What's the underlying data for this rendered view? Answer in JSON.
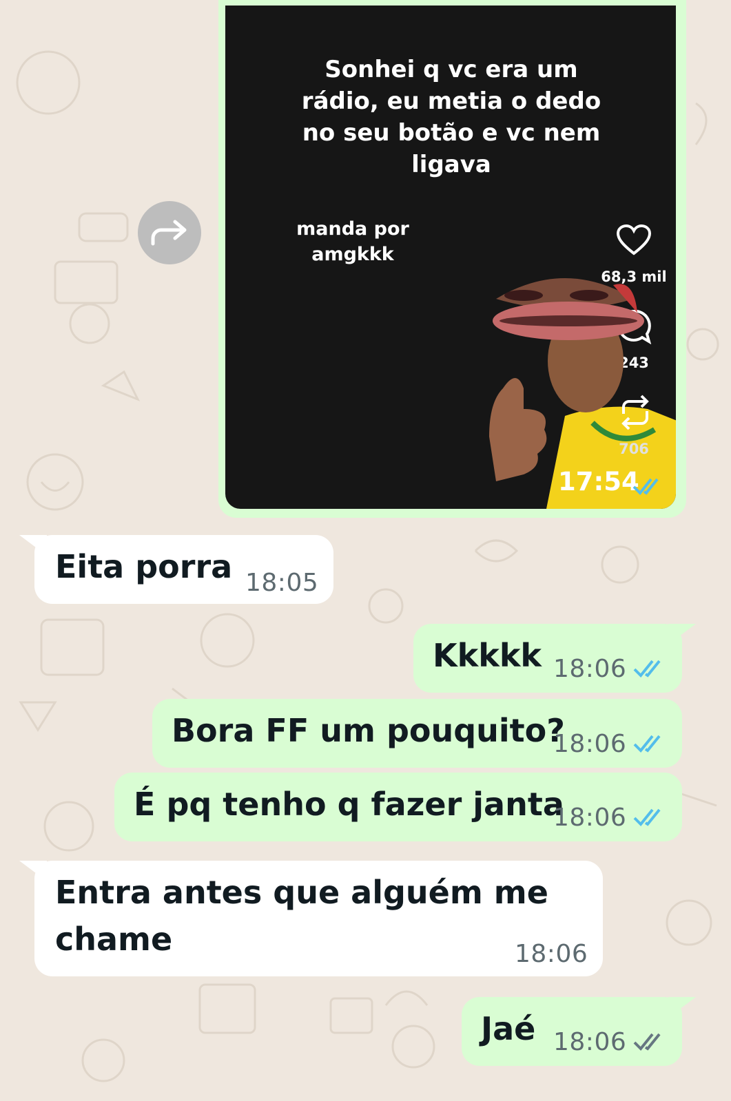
{
  "media_message": {
    "caption": "Sonhei q vc era um\nrádio, eu metia o dedo\nno seu botão e vc nem\nligava",
    "credit": "manda por\namgkkk",
    "likes": "68,3 mil",
    "comments": "243",
    "reposts": "706",
    "time": "17:54",
    "status": "read"
  },
  "messages": [
    {
      "direction": "in",
      "text": "Eita porra",
      "time": "18:05"
    },
    {
      "direction": "out",
      "text": "Kkkkk",
      "time": "18:06",
      "status": "read"
    },
    {
      "direction": "out",
      "text": "Bora FF um pouquito?",
      "time": "18:06",
      "status": "read"
    },
    {
      "direction": "out",
      "text": "É pq tenho q fazer janta",
      "time": "18:06",
      "status": "read"
    },
    {
      "direction": "in",
      "text": "Entra antes que alguém me\nchame",
      "time": "18:06"
    },
    {
      "direction": "out",
      "text": "Jaé",
      "time": "18:06",
      "status": "delivered"
    }
  ],
  "colors": {
    "background": "#efe7de",
    "outgoing_bubble": "#d9fdd3",
    "incoming_bubble": "#ffffff",
    "read_tick": "#53bdeb",
    "delivered_tick": "#667781"
  },
  "icons": {
    "forward": "forward-icon",
    "like": "heart-icon",
    "comment": "comment-icon",
    "repost": "repost-icon",
    "read": "double-check-icon"
  }
}
